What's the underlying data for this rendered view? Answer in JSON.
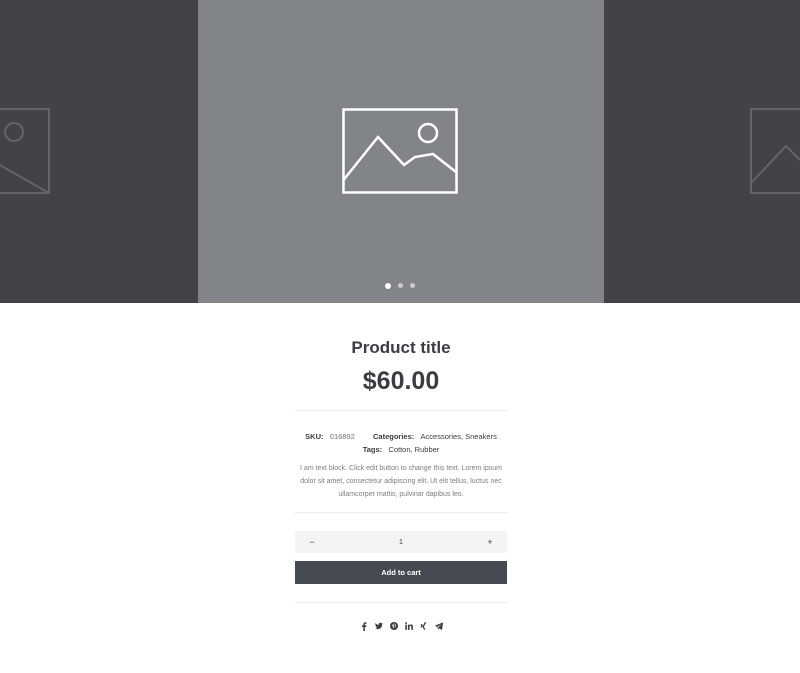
{
  "gallery": {
    "slide_count": 3,
    "active_slide": 1,
    "placeholder_icon": "image-placeholder-icon"
  },
  "product": {
    "title": "Product title",
    "price": "$60.00",
    "sku_label": "SKU:",
    "sku": "016892",
    "categories_label": "Categories:",
    "categories": "Accessories, Sneakers",
    "tags_label": "Tags:",
    "tags": "Cotton, Rubber",
    "description": "I am text block. Click edit button to change this text. Lorem ipsum dolor sit amet, consectetur adipiscing elit. Ut elit tellus, luctus nec ullamcorper mattis, pulvinar dapibus leo."
  },
  "quantity": {
    "minus": "−",
    "value": "1",
    "plus": "+"
  },
  "cart": {
    "label": "Add to cart"
  },
  "share": {
    "icons": [
      "facebook-icon",
      "twitter-icon",
      "pinterest-icon",
      "linkedin-icon",
      "xing-icon",
      "telegram-icon"
    ]
  },
  "colors": {
    "side_slide": "#424347",
    "main_slide": "#818589",
    "button": "#464b53",
    "text": "#3a3d42"
  }
}
